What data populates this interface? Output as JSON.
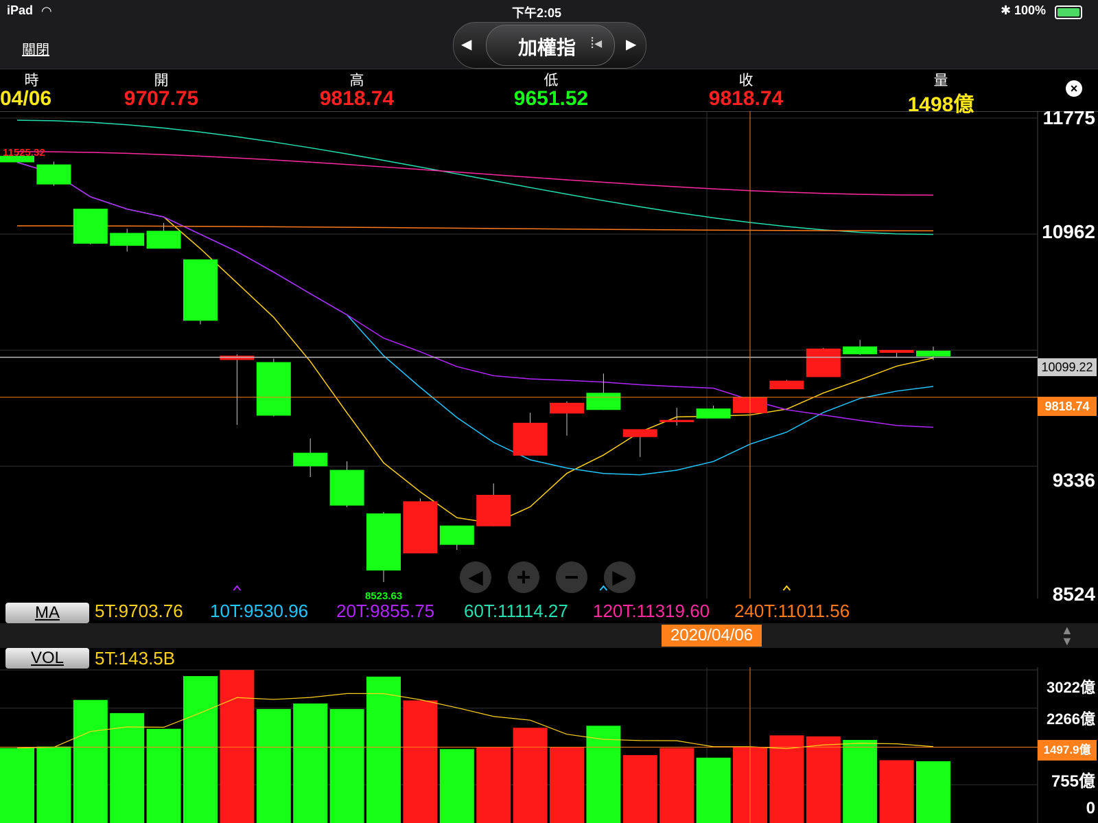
{
  "status": {
    "device": "iPad",
    "time": "下午2:05",
    "battery": "100%"
  },
  "nav": {
    "close": "關閉",
    "index_name": "加權指"
  },
  "ohlc": {
    "headers": {
      "time": "時",
      "open": "開",
      "high": "高",
      "low": "低",
      "close": "收",
      "volume": "量"
    },
    "values": {
      "time": "04/06",
      "open": "9707.75",
      "high": "9818.74",
      "low": "9651.52",
      "close": "9818.74",
      "volume": "1498億"
    }
  },
  "price_axis": {
    "labels": [
      "11775",
      "10962",
      "9336",
      "8524"
    ],
    "current_tag": "10099.22",
    "close_tag": "9818.74"
  },
  "annotations": {
    "high_mark": "11525.32",
    "low_mark": "8523.63"
  },
  "ma": {
    "button": "MA",
    "items": [
      {
        "label": "5T:9703.76",
        "color": "#ffd21a"
      },
      {
        "label": "10T:9530.96",
        "color": "#22c6ff"
      },
      {
        "label": "20T:9855.75",
        "color": "#b026ff"
      },
      {
        "label": "60T:11114.27",
        "color": "#22e0b0"
      },
      {
        "label": "120T:11319.60",
        "color": "#ff2aa0"
      },
      {
        "label": "240T:11011.56",
        "color": "#ff7a1a"
      }
    ]
  },
  "date_tag": "2020/04/06",
  "vol": {
    "button": "VOL",
    "ma_label": "5T:143.5B",
    "axis": [
      "3022億",
      "2266億",
      "755億",
      "0"
    ],
    "current_tag": "1497.9億"
  },
  "colors": {
    "up": "#ff1a1a",
    "down": "#16ff16",
    "accent": "#ff7f1a"
  },
  "chart_data": {
    "type": "candlestick",
    "price_range": [
      8524,
      11775
    ],
    "candles": [
      {
        "o": 11510,
        "h": 11525,
        "l": 11470,
        "c": 11465
      },
      {
        "o": 11450,
        "h": 11470,
        "l": 11300,
        "c": 11310
      },
      {
        "o": 11140,
        "h": 11140,
        "l": 10890,
        "c": 10895
      },
      {
        "o": 10970,
        "h": 11000,
        "l": 10840,
        "c": 10880
      },
      {
        "o": 10985,
        "h": 11040,
        "l": 10860,
        "c": 10860
      },
      {
        "o": 10785,
        "h": 10785,
        "l": 10330,
        "c": 10355
      },
      {
        "o": 10080,
        "h": 10120,
        "l": 9625,
        "c": 10110
      },
      {
        "o": 10065,
        "h": 10090,
        "l": 9685,
        "c": 9690
      },
      {
        "o": 9430,
        "h": 9530,
        "l": 9260,
        "c": 9335
      },
      {
        "o": 9310,
        "h": 9370,
        "l": 9050,
        "c": 9060
      },
      {
        "o": 9005,
        "h": 9015,
        "l": 8524,
        "c": 8605
      },
      {
        "o": 8725,
        "h": 9110,
        "l": 8725,
        "c": 9090
      },
      {
        "o": 8920,
        "h": 8920,
        "l": 8750,
        "c": 8785
      },
      {
        "o": 8915,
        "h": 9215,
        "l": 8915,
        "c": 9135
      },
      {
        "o": 9410,
        "h": 9710,
        "l": 9410,
        "c": 9640
      },
      {
        "o": 9705,
        "h": 9790,
        "l": 9550,
        "c": 9780
      },
      {
        "o": 9850,
        "h": 9985,
        "l": 9730,
        "c": 9730
      },
      {
        "o": 9540,
        "h": 9585,
        "l": 9400,
        "c": 9595
      },
      {
        "o": 9645,
        "h": 9745,
        "l": 9620,
        "c": 9660
      },
      {
        "o": 9740,
        "h": 9760,
        "l": 9670,
        "c": 9670
      },
      {
        "o": 9707.75,
        "h": 9818.74,
        "l": 9651.52,
        "c": 9818.74
      },
      {
        "o": 9875,
        "h": 9940,
        "l": 9875,
        "c": 9935
      },
      {
        "o": 9960,
        "h": 10165,
        "l": 9960,
        "c": 10160
      },
      {
        "o": 10175,
        "h": 10220,
        "l": 10115,
        "c": 10120
      },
      {
        "o": 10130,
        "h": 10130,
        "l": 10095,
        "c": 10150
      },
      {
        "o": 10145,
        "h": 10175,
        "l": 10080,
        "c": 10105
      }
    ],
    "volumes_yi": [
      1480,
      1510,
      2430,
      2170,
      1860,
      2900,
      3020,
      2250,
      2360,
      2250,
      2890,
      2420,
      1460,
      1500,
      1880,
      1500,
      1920,
      1340,
      1480,
      1290,
      1498,
      1730,
      1710,
      1640,
      1240,
      1220
    ],
    "volume_max": 3022
  }
}
